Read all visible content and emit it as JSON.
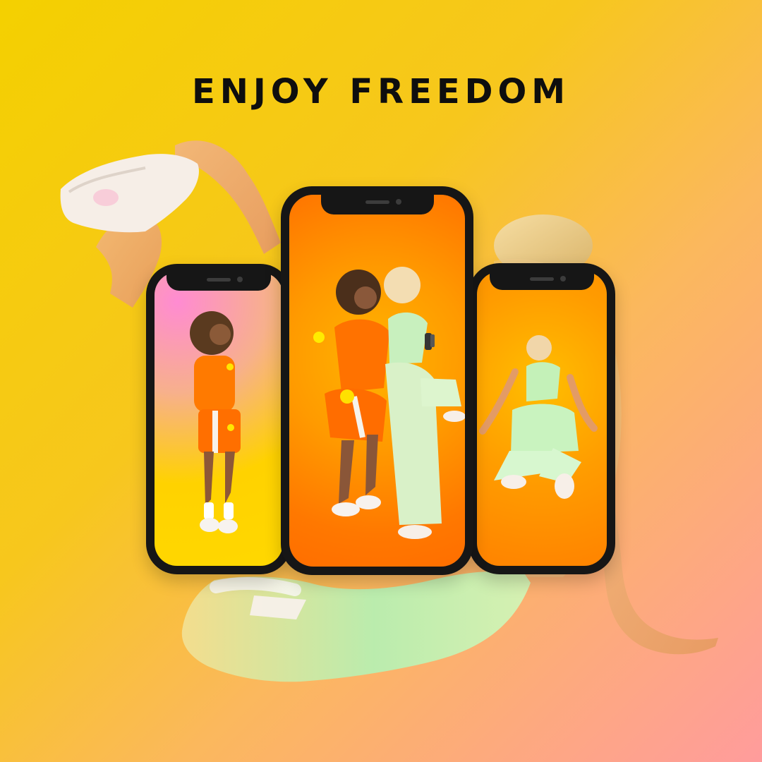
{
  "headline": "ENJOY FREEDOM",
  "colors": {
    "background_start": "#f4d000",
    "background_end": "#ff9c9c",
    "headline_text": "#0e0e0e",
    "phone_frame": "#161616"
  },
  "phones": [
    {
      "position": "left",
      "screen": "photo-dancer-orange"
    },
    {
      "position": "center",
      "screen": "photo-two-dancers"
    },
    {
      "position": "right",
      "screen": "photo-seated-dancer"
    }
  ],
  "background_photo": "woman-seated-lifting-sneaker"
}
